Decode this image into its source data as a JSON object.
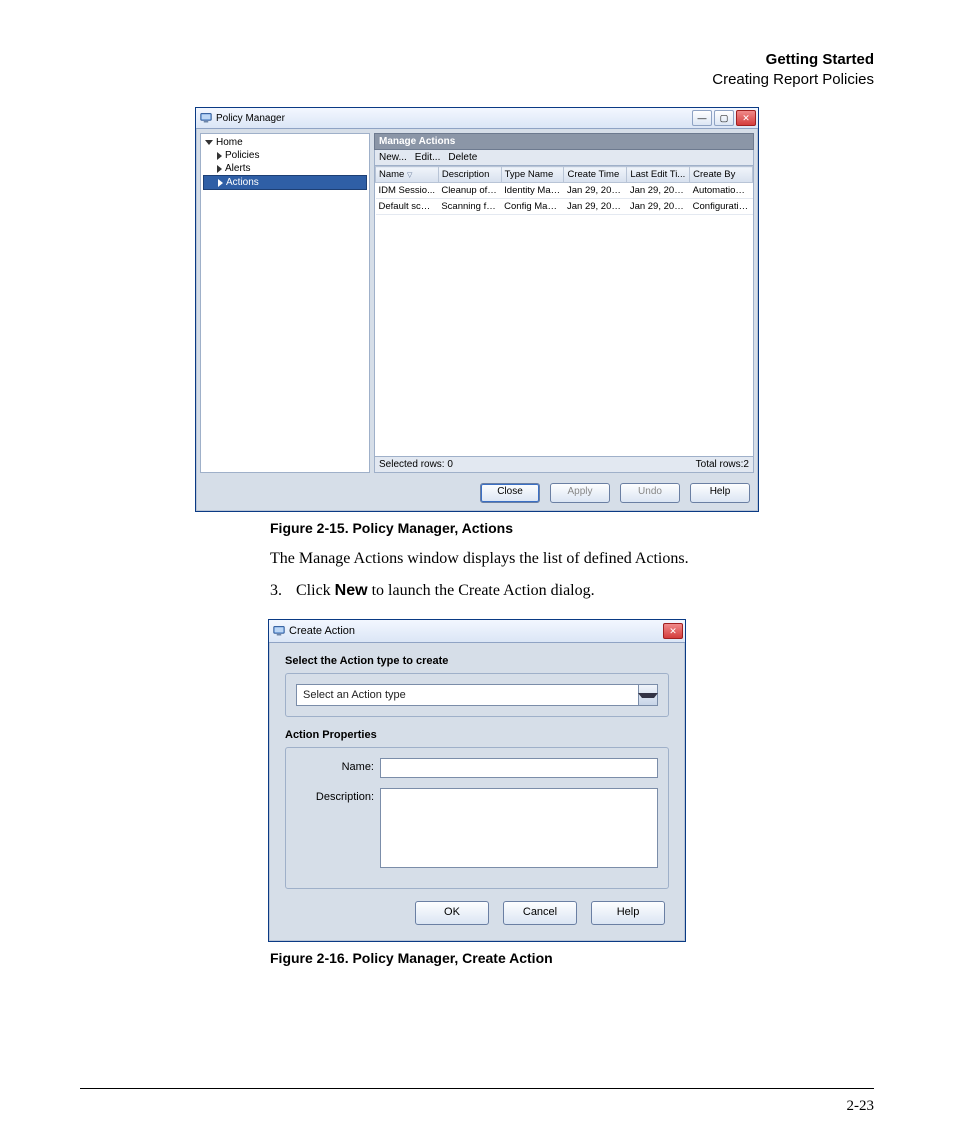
{
  "header": {
    "bold": "Getting Started",
    "sub": "Creating Report Policies"
  },
  "pm": {
    "title": "Policy Manager",
    "tree": {
      "home": "Home",
      "policies": "Policies",
      "alerts": "Alerts",
      "actions": "Actions"
    },
    "section": "Manage Actions",
    "toolbar": {
      "new": "New...",
      "edit": "Edit...",
      "delete": "Delete"
    },
    "cols": [
      "Name",
      "Description",
      "Type Name",
      "Create Time",
      "Last Edit Ti...",
      "Create By"
    ],
    "rows": [
      [
        "IDM Sessio...",
        "Cleanup of i...",
        "Identity Man...",
        "Jan 29, 200...",
        "Jan 29, 200...",
        "Automation ..."
      ],
      [
        "Default scan...",
        "Scanning for...",
        "Config Mana...",
        "Jan 29, 200...",
        "Jan 29, 200...",
        "Configuratio..."
      ]
    ],
    "status": {
      "selected": "Selected rows: 0",
      "total": "Total rows:2"
    },
    "buttons": {
      "close": "Close",
      "apply": "Apply",
      "undo": "Undo",
      "help": "Help"
    }
  },
  "fig15": "Figure 2-15. Policy Manager, Actions",
  "para1": "The Manage Actions window displays the list of defined Actions.",
  "step3": {
    "num": "3.",
    "pre": "Click ",
    "bold": "New",
    "post": " to launch the Create Action dialog."
  },
  "ca": {
    "title": "Create Action",
    "heading": "Select the Action type to create",
    "combo": "Select an Action type",
    "propsHeading": "Action Properties",
    "nameLabel": "Name:",
    "descLabel": "Description:",
    "buttons": {
      "ok": "OK",
      "cancel": "Cancel",
      "help": "Help"
    }
  },
  "fig16": "Figure 2-16. Policy Manager, Create Action",
  "pagenum": "2-23"
}
